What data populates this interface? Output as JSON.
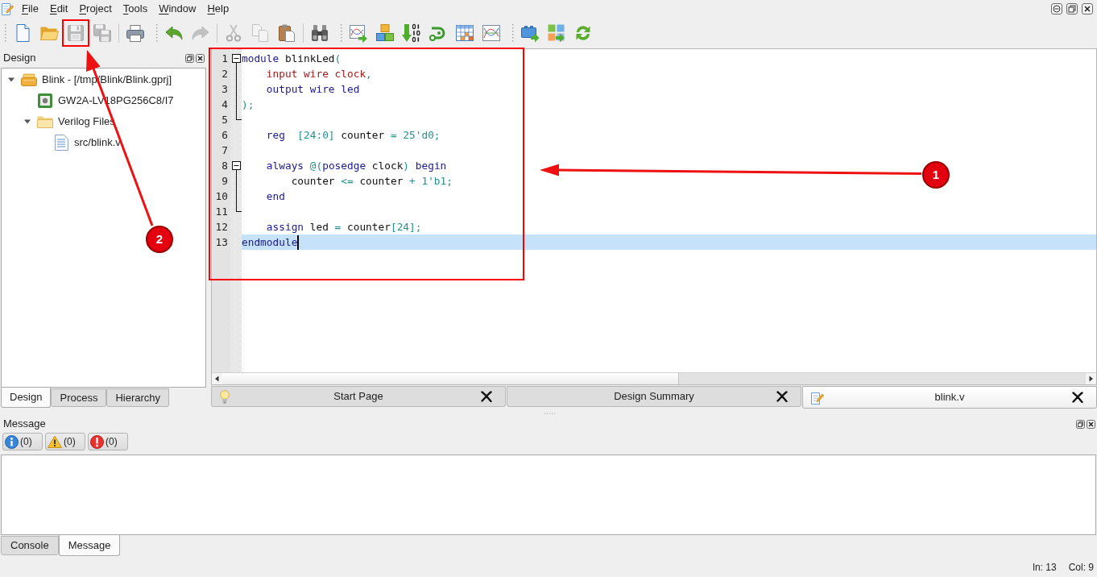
{
  "menu": [
    "File",
    "Edit",
    "Project",
    "Tools",
    "Window",
    "Help"
  ],
  "toolbars": [
    {
      "groups": [
        [
          {
            "kind": "new-file",
            "disabled": false
          },
          {
            "kind": "open",
            "disabled": false
          },
          {
            "kind": "save",
            "disabled": true
          },
          {
            "kind": "save-all",
            "disabled": true
          }
        ],
        [
          {
            "kind": "print",
            "disabled": false
          }
        ]
      ]
    },
    {
      "groups": [
        [
          {
            "kind": "undo",
            "disabled": false
          },
          {
            "kind": "redo",
            "disabled": true
          }
        ],
        [
          {
            "kind": "cut",
            "disabled": true
          },
          {
            "kind": "copy",
            "disabled": true
          },
          {
            "kind": "paste",
            "disabled": false
          }
        ],
        [
          {
            "kind": "find",
            "disabled": false
          }
        ]
      ]
    },
    {
      "groups": [
        [
          {
            "kind": "chart-arrow",
            "disabled": false
          },
          {
            "kind": "cubes",
            "disabled": false
          },
          {
            "kind": "binary-download",
            "disabled": false
          },
          {
            "kind": "route",
            "disabled": false
          },
          {
            "kind": "table",
            "disabled": false
          },
          {
            "kind": "waveform",
            "disabled": false
          }
        ]
      ]
    },
    {
      "groups": [
        [
          {
            "kind": "block-arrow",
            "disabled": false
          },
          {
            "kind": "tiles-arrow",
            "disabled": false
          },
          {
            "kind": "refresh",
            "disabled": false
          }
        ]
      ]
    }
  ],
  "design": {
    "title": "Design",
    "tree": [
      {
        "label": "Blink - [/tmp/Blink/Blink.gprj]",
        "kind": "project",
        "expanded": true,
        "children": [
          {
            "label": "GW2A-LV18PG256C8/I7",
            "kind": "device"
          },
          {
            "label": "Verilog Files",
            "kind": "folder",
            "expanded": true,
            "children": [
              {
                "label": "src/blink.v",
                "kind": "file"
              }
            ]
          }
        ]
      }
    ],
    "tabs": [
      {
        "label": "Design",
        "selected": true
      },
      {
        "label": "Process",
        "selected": false
      },
      {
        "label": "Hierarchy",
        "selected": false
      }
    ]
  },
  "editor": {
    "lines": [
      {
        "number": "1",
        "current": false,
        "expanded": true,
        "tokens": [
          {
            "text": "module",
            "kind": "keyword"
          },
          {
            "text": " blinkLed",
            "kind": "plain"
          },
          {
            "text": "(",
            "kind": "operator"
          }
        ],
        "children": [
          {
            "number": "2",
            "current": false,
            "tokens": [
              {
                "text": "    input wire clock",
                "kind": "port"
              },
              {
                "text": ",",
                "kind": "operator"
              }
            ]
          },
          {
            "number": "3",
            "current": false,
            "tokens": [
              {
                "text": "    output wire led",
                "kind": "keyword"
              }
            ]
          },
          {
            "number": "4",
            "current": false,
            "tokens": [
              {
                "text": ");",
                "kind": "operator"
              }
            ]
          },
          {
            "number": "5",
            "current": false
          }
        ]
      },
      {
        "number": "6",
        "current": false,
        "tokens": [
          {
            "text": "    reg  ",
            "kind": "keyword"
          },
          {
            "text": "[24:0]",
            "kind": "operator"
          },
          {
            "text": " counter ",
            "kind": "plain"
          },
          {
            "text": "= 25'd0;",
            "kind": "operator"
          }
        ]
      },
      {
        "number": "7",
        "current": false
      },
      {
        "number": "8",
        "current": false,
        "expanded": true,
        "tokens": [
          {
            "text": "    always ",
            "kind": "keyword"
          },
          {
            "text": "@(",
            "kind": "operator"
          },
          {
            "text": "posedge",
            "kind": "keyword"
          },
          {
            "text": " clock",
            "kind": "plain"
          },
          {
            "text": ")",
            "kind": "operator"
          },
          {
            "text": " begin",
            "kind": "keyword"
          }
        ],
        "children": [
          {
            "number": "9",
            "current": false,
            "tokens": [
              {
                "text": "        counter ",
                "kind": "plain"
              },
              {
                "text": "<=",
                "kind": "operator"
              },
              {
                "text": " counter ",
                "kind": "plain"
              },
              {
                "text": "+ 1'b1;",
                "kind": "operator"
              }
            ]
          },
          {
            "number": "10",
            "current": false,
            "tokens": [
              {
                "text": "    end",
                "kind": "keyword"
              }
            ]
          },
          {
            "number": "11",
            "current": false
          }
        ]
      },
      {
        "number": "12",
        "current": false,
        "tokens": [
          {
            "text": "    assign",
            "kind": "keyword"
          },
          {
            "text": " led ",
            "kind": "plain"
          },
          {
            "text": "=",
            "kind": "operator"
          },
          {
            "text": " counter",
            "kind": "plain"
          },
          {
            "text": "[24];",
            "kind": "operator"
          }
        ]
      },
      {
        "number": "13",
        "current": true,
        "tokens": [
          {
            "text": "endmodule",
            "kind": "keyword"
          }
        ]
      }
    ]
  },
  "editor_tabs": [
    {
      "label": "Start Page",
      "kind": "start",
      "selected": false
    },
    {
      "label": "Design Summary",
      "kind": "summary",
      "selected": false
    },
    {
      "label": "blink.v",
      "kind": "source",
      "selected": true
    }
  ],
  "message_panel": {
    "title": "Message",
    "filters": [
      {
        "kind": "info",
        "label": "(0)"
      },
      {
        "kind": "warning",
        "label": "(0)"
      },
      {
        "kind": "error",
        "label": "(0)"
      }
    ],
    "tabs": [
      {
        "label": "Console",
        "selected": false
      },
      {
        "label": "Message",
        "selected": true
      }
    ]
  },
  "status_bar": {
    "line": "ln: 13",
    "column": "Col: 9"
  },
  "annotations": [
    {
      "label": "1",
      "kind": "editor-callout"
    },
    {
      "label": "2",
      "kind": "save-button-callout"
    }
  ]
}
